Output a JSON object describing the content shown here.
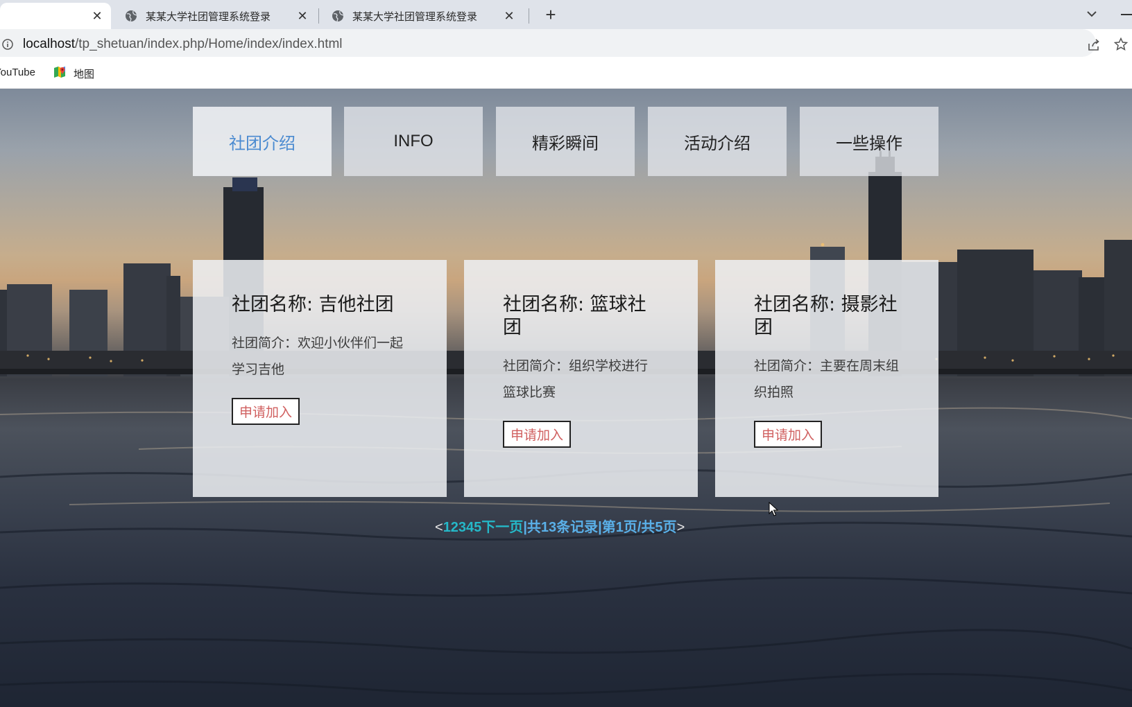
{
  "browser": {
    "tabs": [
      {
        "title": "",
        "active": true
      },
      {
        "title": "某某大学社团管理系统登录",
        "active": false
      },
      {
        "title": "某某大学社团管理系统登录",
        "active": false
      }
    ],
    "new_tab_label": "+",
    "url_host": "localhost",
    "url_path": "/tp_shetuan/index.php/Home/index/index.html",
    "bookmarks": [
      "YouTube",
      "地图"
    ]
  },
  "nav": {
    "items": [
      {
        "label": "社团介绍",
        "active": true
      },
      {
        "label": "INFO",
        "active": false
      },
      {
        "label": "精彩瞬间",
        "active": false
      },
      {
        "label": "活动介绍",
        "active": false
      },
      {
        "label": "一些操作",
        "active": false
      }
    ],
    "active_color": "#4a8ad0"
  },
  "clubs": [
    {
      "name": "社团名称: 吉他社团",
      "intro": "社团简介：欢迎小伙伴们一起学习吉他",
      "join_label": "申请加入"
    },
    {
      "name": "社团名称: 篮球社团",
      "intro": "社团简介：组织学校进行篮球比赛",
      "join_label": "申请加入"
    },
    {
      "name": "社团名称: 摄影社团",
      "intro": "社团简介：主要在周末组织拍照",
      "join_label": "申请加入"
    }
  ],
  "pagination": {
    "open": "<",
    "pages": "12345下一页",
    "summary": "|共13条记录|第1页/共5页",
    "close": ">"
  }
}
